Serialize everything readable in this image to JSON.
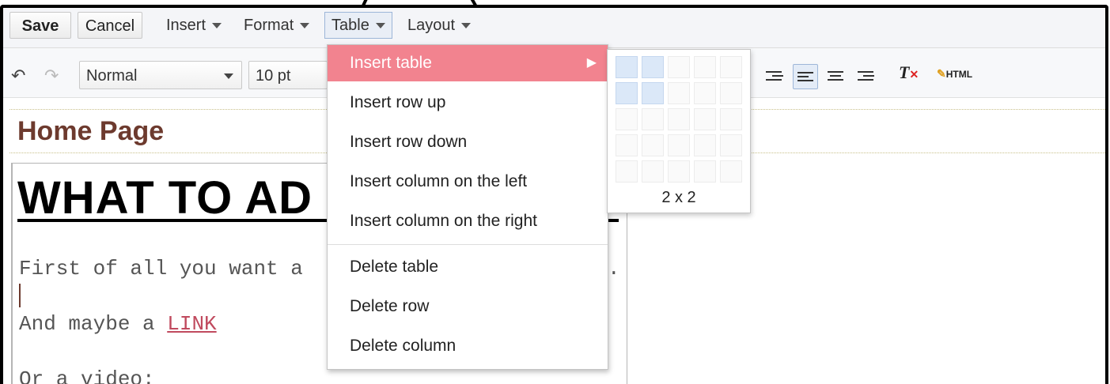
{
  "toolbar_top": {
    "save_label": "Save",
    "cancel_label": "Cancel",
    "menus": [
      "Insert",
      "Format",
      "Table",
      "Layout"
    ]
  },
  "toolbar_format": {
    "style_select": "Normal",
    "size_select": "10 pt",
    "html_label": "HTML"
  },
  "page": {
    "title": "Home Page",
    "headline": "WHAT TO AD",
    "line1": "First of all you want a",
    "line1_end": ".",
    "line2_prefix": "And maybe a ",
    "line2_link": "LINK",
    "line3": "Or a video:"
  },
  "table_menu": {
    "items": [
      "Insert table",
      "Insert row up",
      "Insert row down",
      "Insert column on the left",
      "Insert column on the right",
      "Delete table",
      "Delete row",
      "Delete column"
    ],
    "highlighted": "Insert table",
    "highlight_color": "#f2838f"
  },
  "table_grid": {
    "label": "2 x 2",
    "rows_selected": 2,
    "cols_selected": 2
  }
}
